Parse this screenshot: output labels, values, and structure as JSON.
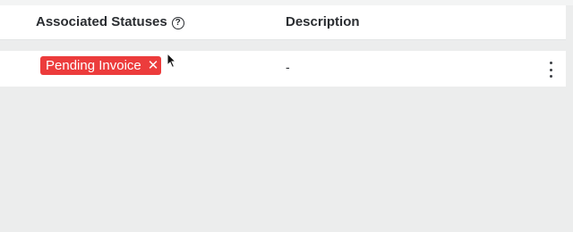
{
  "table": {
    "columns": {
      "statuses": "Associated Statuses",
      "statuses_help_icon": "question-circle-icon",
      "description": "Description"
    },
    "rows": [
      {
        "status_tag": {
          "label": "Pending Invoice",
          "remove_symbol": "✕",
          "color": "#ec3c3c"
        },
        "description": "-",
        "menu_icon": "vertical-ellipsis-icon"
      }
    ]
  }
}
